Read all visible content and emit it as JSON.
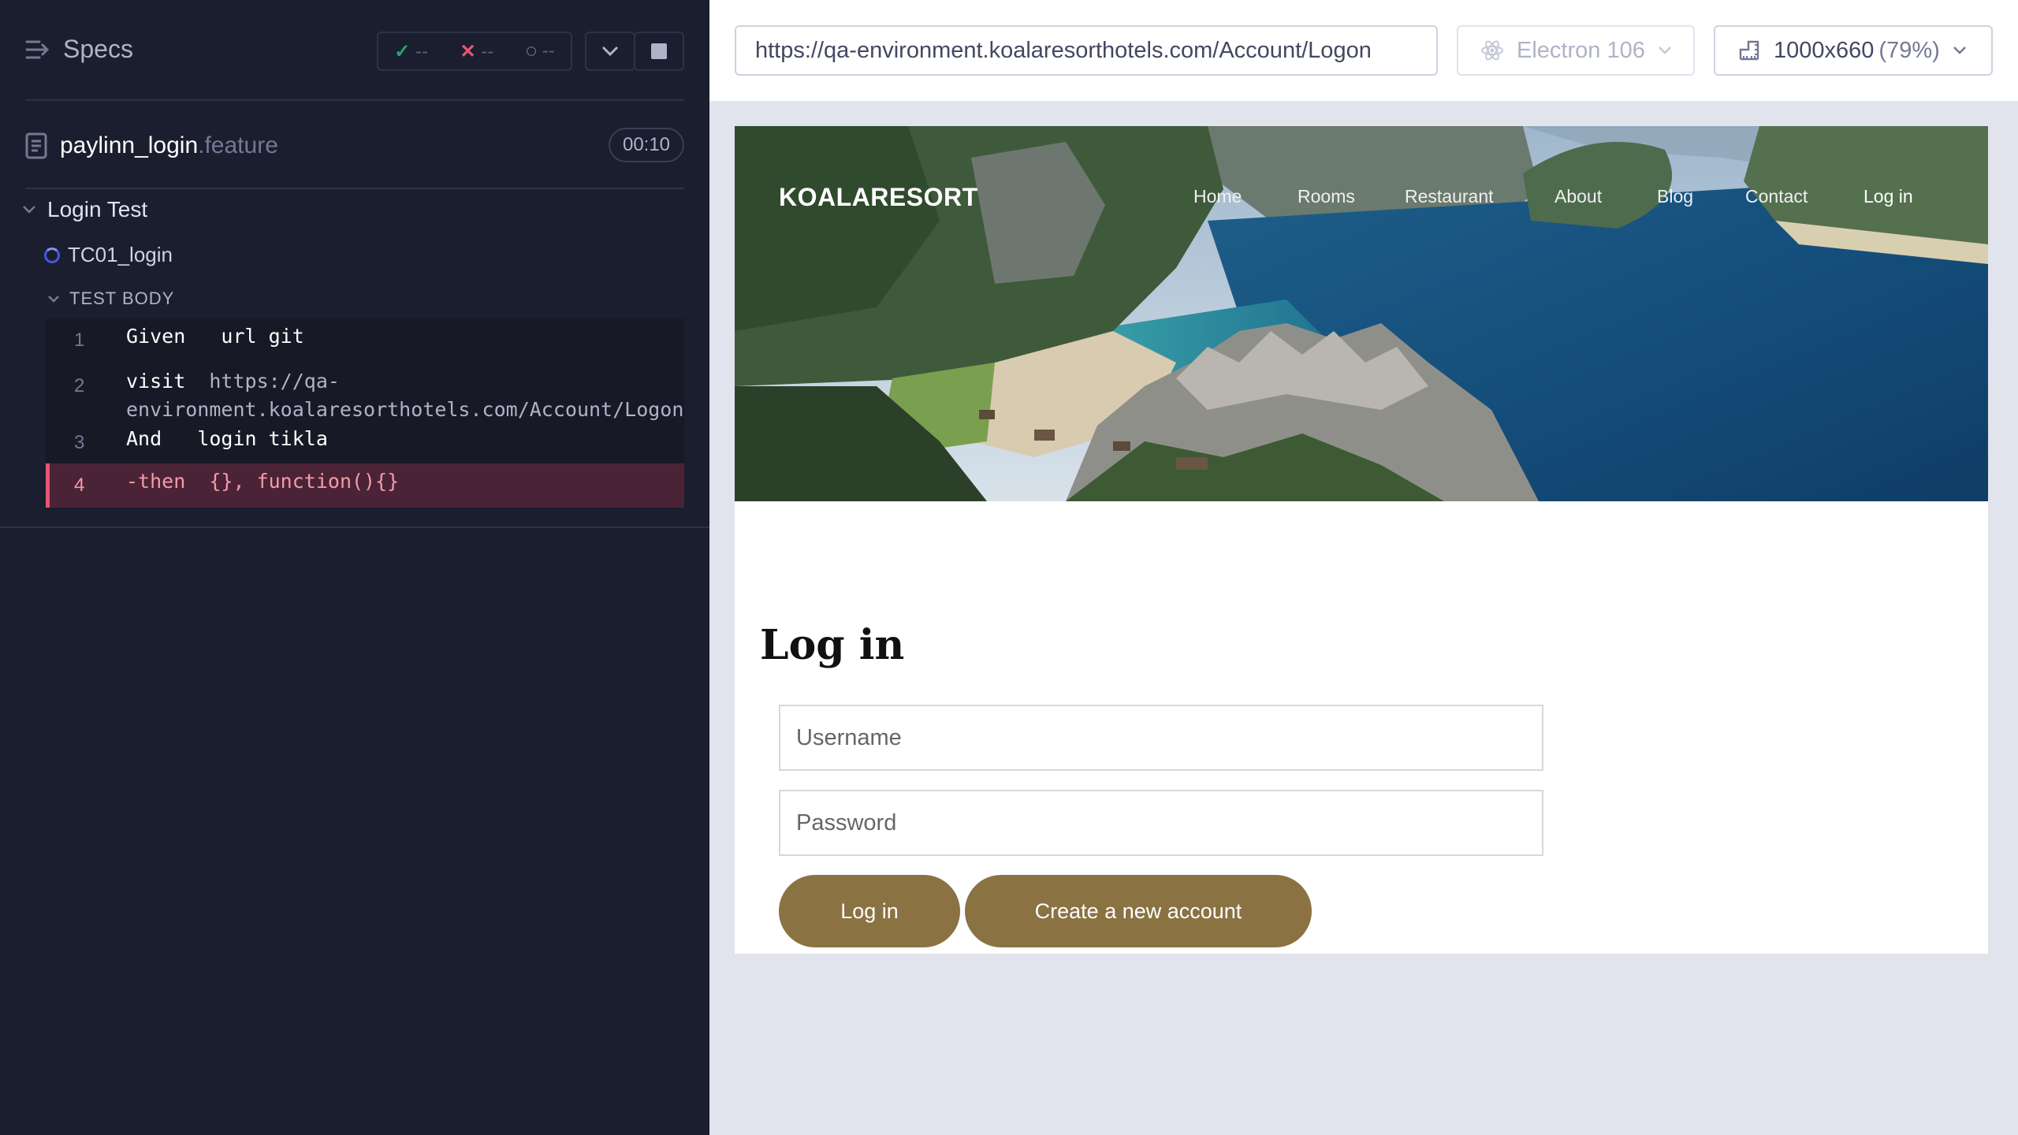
{
  "reporter": {
    "title": "Specs",
    "stats": {
      "passed": "--",
      "failed": "--",
      "pending": "--"
    },
    "file": {
      "name": "paylinn_login",
      "ext": ".feature",
      "duration": "00:10"
    },
    "suite": "Login Test",
    "test": "TC01_login",
    "body_label": "TEST BODY",
    "commands": [
      {
        "num": "1",
        "keyword": "Given",
        "arg": "url git"
      },
      {
        "num": "2",
        "keyword": "visit",
        "arg_line1": "https://qa-",
        "arg_line2": "environment.koalaresorthotels.com/Account/Logon"
      },
      {
        "num": "3",
        "keyword": "And",
        "arg": "login tikla"
      },
      {
        "num": "4",
        "keyword": "-then",
        "arg": "{}, function(){}"
      }
    ]
  },
  "runner": {
    "url": "https://qa-environment.koalaresorthotels.com/Account/Logon",
    "browser": "Electron 106",
    "viewport": "1000x660",
    "zoom": "(79%)"
  },
  "site": {
    "brand": "KOALARESORT",
    "nav": [
      "Home",
      "Rooms",
      "Restaurant",
      "About",
      "Blog",
      "Contact",
      "Log in"
    ],
    "login_title": "Log in",
    "username_placeholder": "Username",
    "password_placeholder": "Password",
    "login_button": "Log in",
    "create_button": "Create a new account"
  },
  "colors": {
    "accent": "#8a7242",
    "fail": "#e45770",
    "pass": "#1fa971"
  }
}
